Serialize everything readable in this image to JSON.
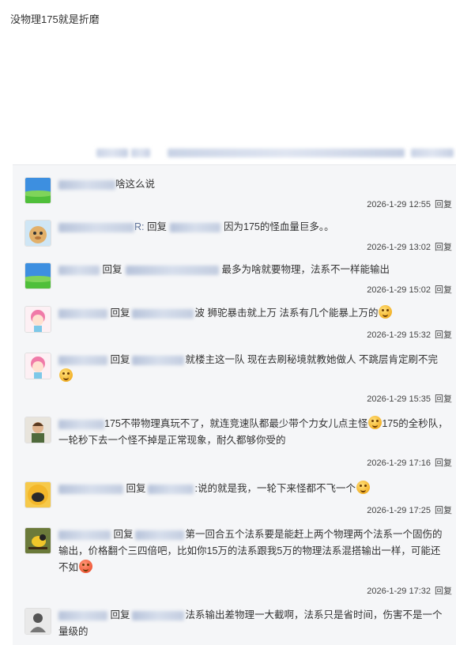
{
  "post": {
    "text": "没物理175就是折磨"
  },
  "comments": [
    {
      "text": "啥这么说",
      "time": "2026-1-29 12:55",
      "reply": "回复"
    },
    {
      "prefix": "R:",
      "reply_word": "回复",
      "text": "因为175的怪血量巨多。。",
      "time": "2026-1-29 13:02",
      "reply": "回复"
    },
    {
      "reply_word": "回复",
      "text": "最多为啥就要物理，法系不一样能输出",
      "time": "2026-1-29 15:02",
      "reply": "回复"
    },
    {
      "reply_word": "回复",
      "text": "波 狮驼暴击就上万 法系有几个能暴上万的",
      "time": "2026-1-29 15:32",
      "reply": "回复"
    },
    {
      "reply_word": "回复",
      "text": "就楼主这一队 现在去刷秘境就教她做人 不跳层肯定刷不完",
      "time": "2026-1-29 15:35",
      "reply": "回复"
    },
    {
      "text": "175不带物理真玩不了，就连竞速队都最少带个力女儿点主怪",
      "text2": "175的全秒队，一轮秒下去一个怪不掉是正常现象，耐久都够你受的",
      "time": "2026-1-29 17:16",
      "reply": "回复"
    },
    {
      "reply_word": "回复",
      "text": ":说的就是我，一轮下来怪都不飞一个",
      "time": "2026-1-29 17:25",
      "reply": "回复"
    },
    {
      "reply_word": "回复",
      "text": "第一回合五个法系要是能赶上两个物理两个法系一个固伤的输出，价格翻个三四倍吧，比如你15万的法系跟我5万的物理法系混搭输出一样，可能还不如",
      "time": "2026-1-29 17:32",
      "reply": "回复"
    },
    {
      "reply_word": "回复",
      "text": "法系输出差物理一大截啊，法系只是省时间，伤害不是一个量级的"
    }
  ],
  "colors": {
    "panel": "#f5f6f8",
    "link": "#5c7096"
  }
}
